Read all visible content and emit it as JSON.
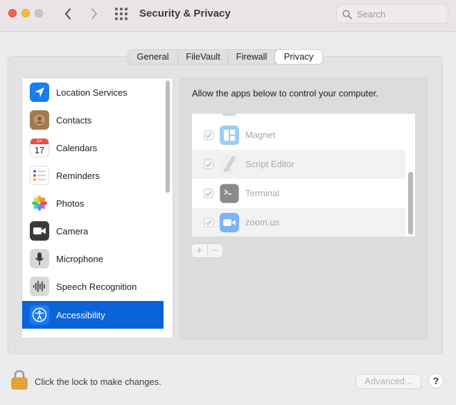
{
  "window": {
    "title": "Security & Privacy",
    "search_placeholder": "Search"
  },
  "tabs": [
    {
      "label": "General",
      "active": false
    },
    {
      "label": "FileVault",
      "active": false
    },
    {
      "label": "Firewall",
      "active": false
    },
    {
      "label": "Privacy",
      "active": true
    }
  ],
  "sidebar": {
    "items": [
      {
        "label": "Location Services",
        "icon": "location-arrow-icon"
      },
      {
        "label": "Contacts",
        "icon": "contacts-icon"
      },
      {
        "label": "Calendars",
        "icon": "calendar-icon",
        "cal_month": "JUL",
        "cal_day": "17"
      },
      {
        "label": "Reminders",
        "icon": "reminders-icon"
      },
      {
        "label": "Photos",
        "icon": "photos-icon"
      },
      {
        "label": "Camera",
        "icon": "camera-icon"
      },
      {
        "label": "Microphone",
        "icon": "microphone-icon"
      },
      {
        "label": "Speech Recognition",
        "icon": "waveform-icon"
      },
      {
        "label": "Accessibility",
        "icon": "accessibility-icon",
        "selected": true
      }
    ]
  },
  "content": {
    "description": "Allow the apps below to control your computer.",
    "apps": [
      {
        "name": "Magnet",
        "checked": true,
        "icon": "magnet-app-icon"
      },
      {
        "name": "Script Editor",
        "checked": true,
        "icon": "script-editor-icon"
      },
      {
        "name": "Terminal",
        "checked": true,
        "icon": "terminal-icon"
      },
      {
        "name": "zoom.us",
        "checked": true,
        "icon": "zoom-icon"
      }
    ],
    "add_label": "+",
    "remove_label": "−"
  },
  "footer": {
    "lock_text": "Click the lock to make changes.",
    "advanced_label": "Advanced...",
    "help_label": "?"
  },
  "colors": {
    "selection": "#0a64d8",
    "close": "#fe5f57",
    "minimize": "#febc2e"
  }
}
